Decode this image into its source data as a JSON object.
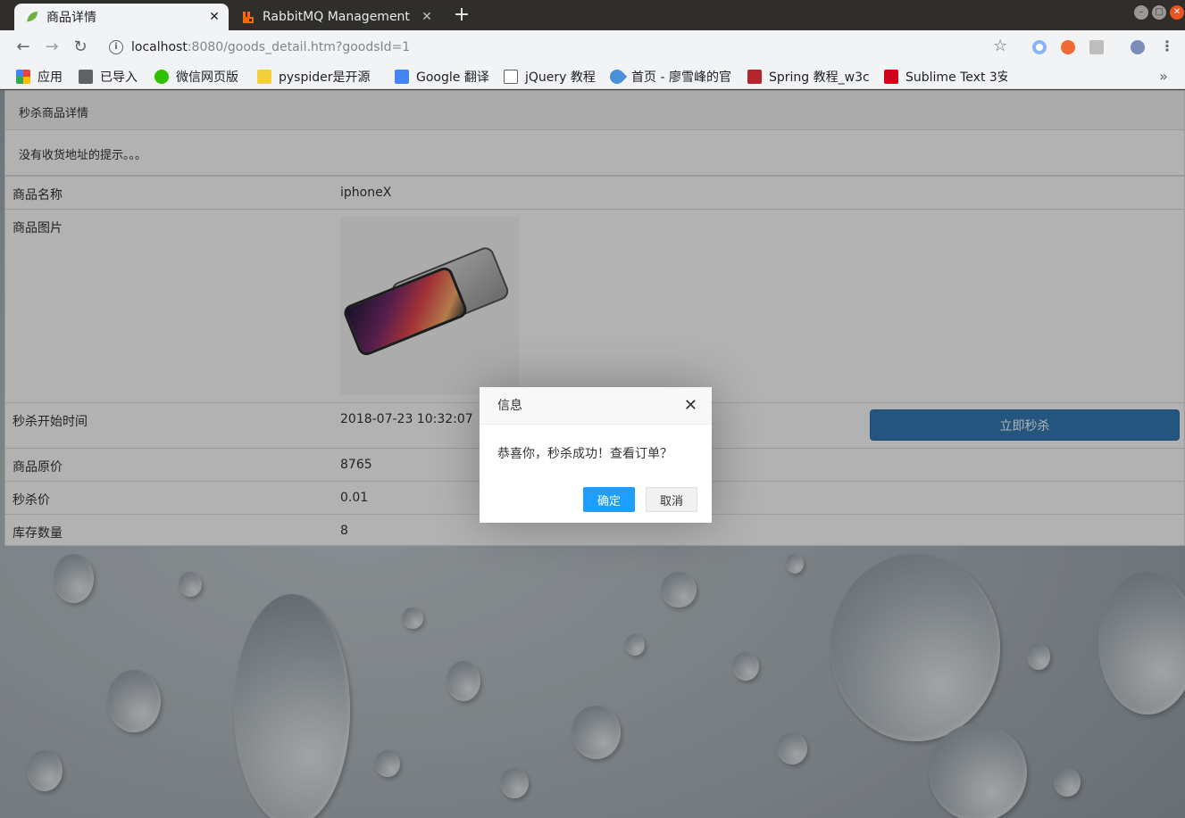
{
  "browser": {
    "tabs": [
      {
        "title": "商品详情",
        "active": true
      },
      {
        "title": "RabbitMQ Management",
        "active": false
      }
    ],
    "new_tab_label": "+",
    "url_host": "localhost",
    "url_rest": ":8080/goods_detail.htm?goodsId=1",
    "bookmarks": [
      {
        "label": "应用",
        "icon": "apps-grid-icon"
      },
      {
        "label": "已导入",
        "icon": "folder-icon"
      },
      {
        "label": "微信网页版",
        "icon": "wechat-icon"
      },
      {
        "label": "pyspider是开源",
        "icon": "pencil-icon"
      },
      {
        "label": "Google 翻译",
        "icon": "google-translate-icon"
      },
      {
        "label": "jQuery 教程",
        "icon": "page-icon"
      },
      {
        "label": "首页 - 廖雪峰的官",
        "icon": "rocket-icon"
      },
      {
        "label": "Spring 教程_w3c",
        "icon": "w3c-icon"
      },
      {
        "label": "Sublime Text 3安",
        "icon": "sublime-icon"
      }
    ],
    "bookmarks_overflow": "»"
  },
  "page": {
    "heading": "秒杀商品详情",
    "notice": "没有收货地址的提示。。。",
    "rows": {
      "name": {
        "label": "商品名称",
        "value": "iphoneX"
      },
      "image": {
        "label": "商品图片"
      },
      "start": {
        "label": "秒杀开始时间",
        "value": "2018-07-23 10:32:07"
      },
      "price": {
        "label": "商品原价",
        "value": "8765"
      },
      "miaosha_price": {
        "label": "秒杀价",
        "value": "0.01"
      },
      "stock": {
        "label": "库存数量",
        "value": "8"
      }
    },
    "buy_button": "立即秒杀"
  },
  "dialog": {
    "title": "信息",
    "close": "✕",
    "message": "恭喜你，秒杀成功！查看订单？",
    "confirm": "确定",
    "cancel": "取消"
  },
  "colors": {
    "primary_button": "#1e9fff",
    "buy_button": "#337ab7"
  }
}
